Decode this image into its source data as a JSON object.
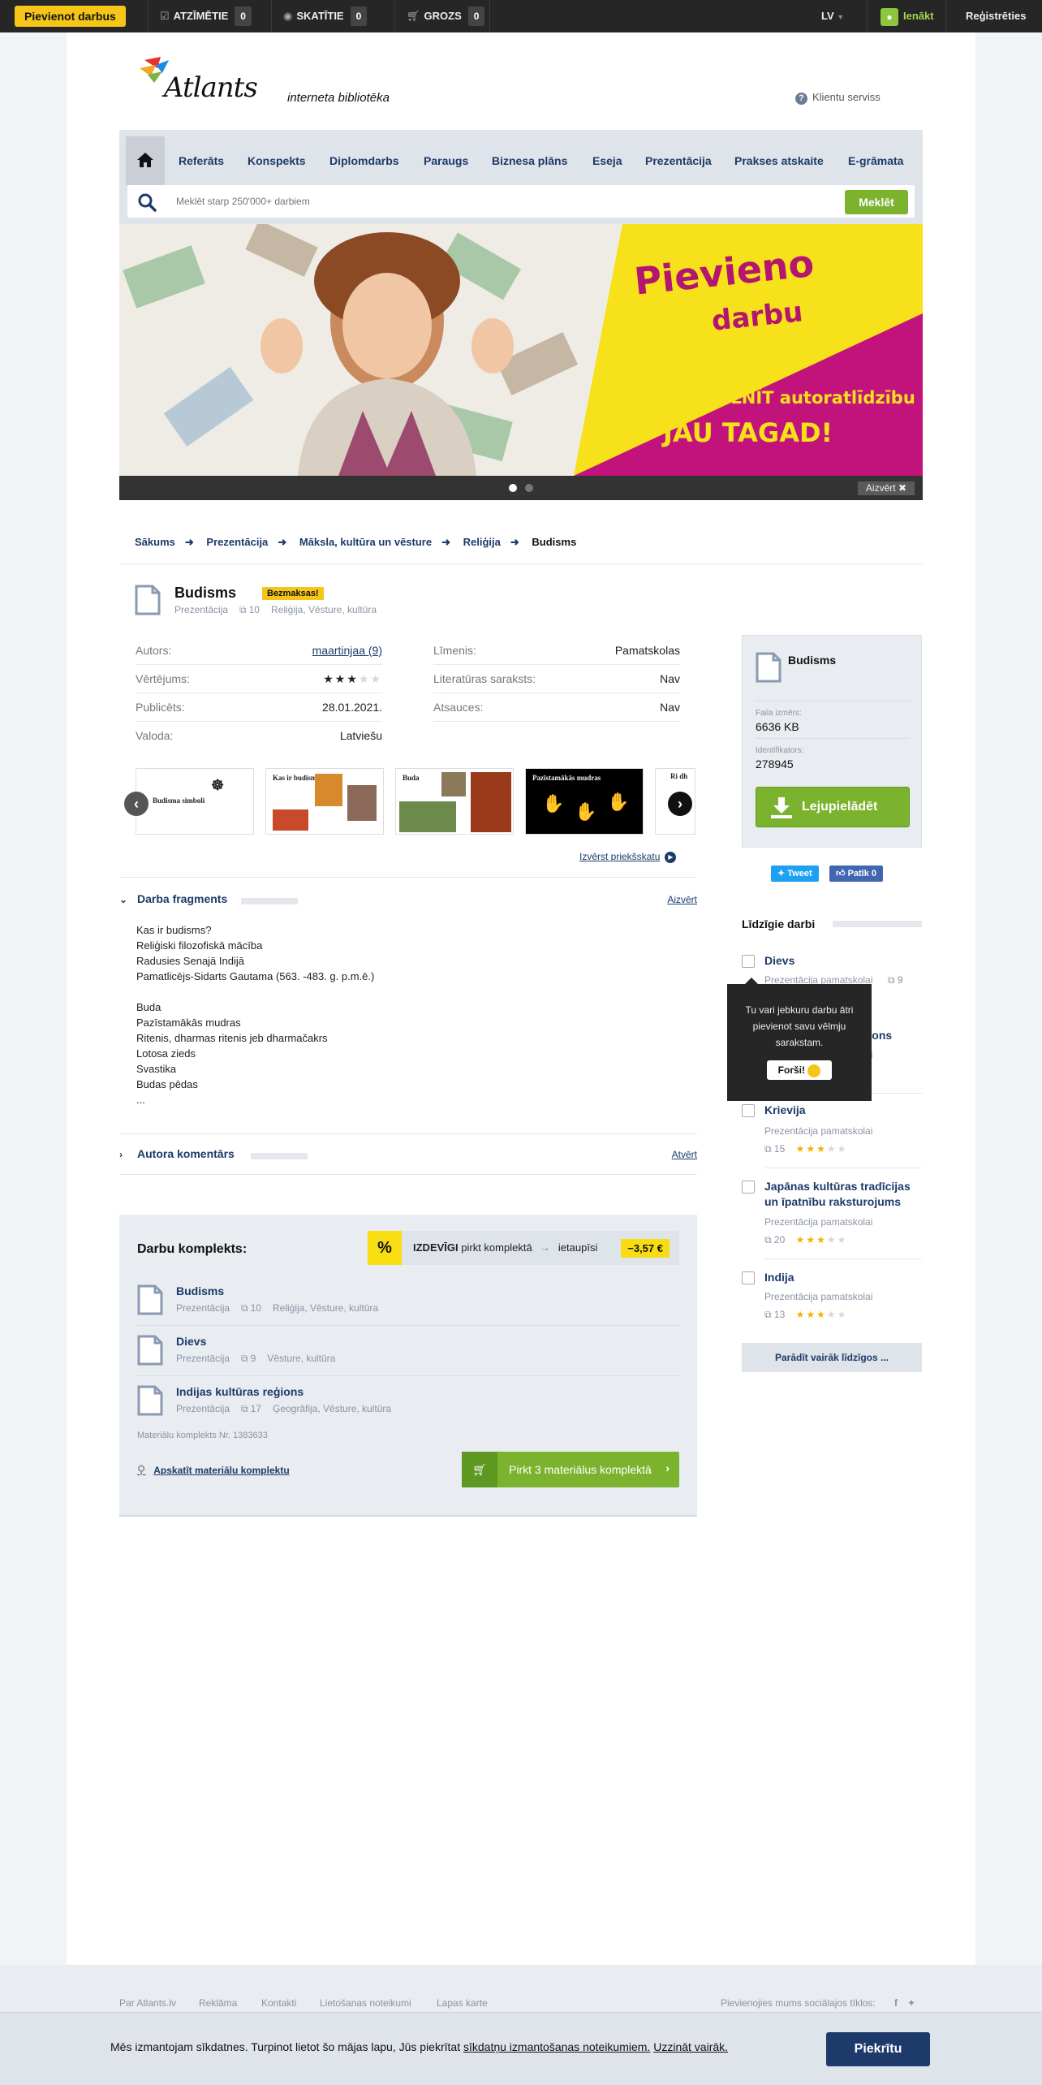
{
  "topbar": {
    "add_work": "Pievienot darbus",
    "marked_label": "ATZĪMĒTIE",
    "marked_count": "0",
    "viewed_label": "SKATĪTIE",
    "viewed_count": "0",
    "cart_label": "GROZS",
    "cart_count": "0",
    "language": "LV",
    "login": "Ienākt",
    "register": "Reģistrēties"
  },
  "header": {
    "logo_text": "Atlants",
    "tagline": "interneta bibliotēka",
    "client_service": "Klientu serviss"
  },
  "nav": {
    "items": [
      "Referāts",
      "Konspekts",
      "Diplomdarbs",
      "Paraugs",
      "Biznesa plāns",
      "Eseja",
      "Prezentācija",
      "Prakses atskaite",
      "E-grāmata"
    ],
    "search_placeholder": "Meklēt starp 250'000+ darbiem",
    "search_button": "Meklēt"
  },
  "banner": {
    "line1": "Pievieno",
    "line2": "darbu",
    "line3": "un sāc PELNĪT autoratlīdzību",
    "line4": "JAU TAGAD!",
    "close_label": "Aizvērt",
    "colors": {
      "yellow": "#f7e11b",
      "magenta": "#c2137c"
    }
  },
  "breadcrumb": [
    "Sākums",
    "Prezentācija",
    "Māksla, kultūra un vēsture",
    "Reliģija",
    "Budisms"
  ],
  "doc": {
    "title": "Budisms",
    "badge": "Bezmaksas!",
    "type": "Prezentācija",
    "pages": "10",
    "categories": "Reliģija, Vēsture, kultūra"
  },
  "meta_left": [
    {
      "k": "Autors:",
      "v": "maartinjaa (9)"
    },
    {
      "k": "Vērtējums:",
      "v": ""
    },
    {
      "k": "Publicēts:",
      "v": "28.01.2021."
    },
    {
      "k": "Valoda:",
      "v": "Latviešu"
    }
  ],
  "meta_right": [
    {
      "k": "Līmenis:",
      "v": "Pamatskolas"
    },
    {
      "k": "Literatūras saraksts:",
      "v": "Nav"
    },
    {
      "k": "Atsauces:",
      "v": "Nav"
    }
  ],
  "rating": {
    "stars": 3,
    "max": 5
  },
  "slides": [
    {
      "caption": "Budisma simboli"
    },
    {
      "caption": "Kas ir budisms?"
    },
    {
      "caption": "Buda"
    },
    {
      "caption": "Pazīstamākās mudras"
    },
    {
      "caption": "Ri dh"
    }
  ],
  "expand_preview": "Izvērst priekšskatu",
  "fragment": {
    "label": "Darba fragments",
    "action": "Aizvērt",
    "lines": [
      "Kas ir budisms?",
      "Reliģiski filozofiskā mācība",
      "Radusies Senajā Indijā",
      "Pamatlicējs-Sidarts Gautama (563. -483. g. p.m.ē.)",
      "",
      "Buda",
      "Pazīstamākās mudras",
      "Ritenis, dharmas ritenis jeb dharmačakrs",
      "Lotosa zieds",
      "Svastika",
      "Budas pēdas",
      "..."
    ]
  },
  "author_comment": {
    "label": "Autora komentārs",
    "action": "Atvērt"
  },
  "kompl": {
    "heading": "Darbu komplekts:",
    "deal_pct": "%",
    "deal_text_bold": "IZDEVĪGI",
    "deal_text": "pirkt komplektā",
    "deal_save": "ietaupīsi",
    "deal_price": "−3,57 €",
    "items": [
      {
        "name": "Budisms",
        "type": "Prezentācija",
        "pages": "10",
        "cats": "Reliģija, Vēsture, kultūra"
      },
      {
        "name": "Dievs",
        "type": "Prezentācija",
        "pages": "9",
        "cats": "Vēsture, kultūra"
      },
      {
        "name": "Indijas kultūras reģions",
        "type": "Prezentācija",
        "pages": "17",
        "cats": "Ģeogrāfija, Vēsture, kultūra"
      }
    ],
    "number": "Materiālu komplekts Nr. 1383633",
    "view_link": "Apskatīt materiālu komplektu",
    "buy_button": "Pirkt 3 materiālus komplektā"
  },
  "sidebox": {
    "name": "Budisms",
    "size_label": "Faila izmērs:",
    "size": "6636 KB",
    "id_label": "Identifikators:",
    "id": "278945",
    "download": "Lejupielādēt"
  },
  "social": {
    "tweet": "Tweet",
    "like": "Patīk 0"
  },
  "similar": {
    "heading": "Līdzīgie darbi",
    "items": [
      {
        "name": "Dievs",
        "type": "Prezentācija pamatskolai",
        "pages": "9",
        "stars": 3
      },
      {
        "name": "Indijas kultūras reģions",
        "type": "Prezentācija pamatskolai",
        "pages": "",
        "stars": 3
      },
      {
        "name": "Krievija",
        "type": "Prezentācija pamatskolai",
        "pages": "15",
        "stars": 3
      },
      {
        "name": "Japānas kultūras tradīcijas un īpatnību raksturojums",
        "type": "Prezentācija pamatskolai",
        "pages": "20",
        "stars": 3
      },
      {
        "name": "Indija",
        "type": "Prezentācija pamatskolai",
        "pages": "13",
        "stars": 3
      }
    ],
    "more": "Parādīt vairāk līdzīgos ..."
  },
  "tooltip": {
    "text": "Tu vari jebkuru darbu ātri pievienot savu vēlmju sarakstam.",
    "ok": "Forši!"
  },
  "footer": {
    "links": [
      "Par Atlants.lv",
      "Reklāma",
      "Kontakti",
      "Lietošanas noteikumi",
      "Lapas karte"
    ],
    "social_label": "Pievienojies mums sociālajos tīklos:"
  },
  "cookie": {
    "text": "Mēs izmantojam sīkdatnes. Turpinot lietot šo mājas lapu, Jūs piekrītat",
    "link1": "sīkdatņu izmantošanas noteikumiem.",
    "link2": "Uzzināt vairāk.",
    "button": "Piekrītu"
  }
}
